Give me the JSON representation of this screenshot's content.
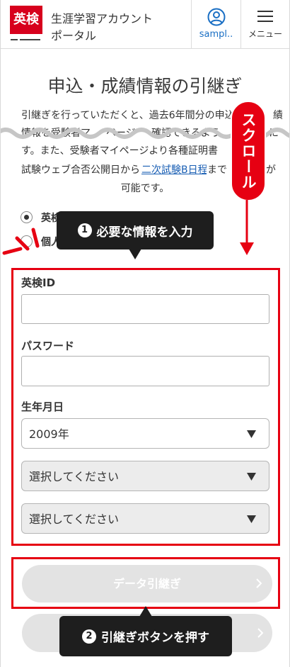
{
  "header": {
    "logo_text": "英検",
    "title_line1": "生涯学習アカウント",
    "title_line2": "ポータル",
    "user_label": "sampl..",
    "menu_label": "メニュー"
  },
  "page": {
    "heading": "申込・成績情報の引継ぎ",
    "intro": {
      "line1a": "引継ぎを行っていただくと、過去6年間分の申込",
      "line1b": "績",
      "line2a": "情報を受験者マ",
      "line2b": "ページ",
      "line2c": "確認できるよう",
      "line2d": "に",
      "line3a": "す。また、受験者マイページより各種証明書",
      "line4a": "試験ウェブ合否公開日から",
      "line4_link": "二次試験B日程",
      "line4b": "まで",
      "line4c": "が",
      "line5": "可能です。"
    }
  },
  "options": [
    {
      "label": "英検",
      "selected": true
    },
    {
      "label": "個人",
      "selected": false
    }
  ],
  "form": {
    "eiken_id_label": "英検ID",
    "eiken_id_value": "",
    "password_label": "パスワード",
    "password_value": "",
    "birth_label": "生年月日",
    "year_value": "2009年",
    "month_value": "選択してください",
    "day_value": "選択してください"
  },
  "buttons": {
    "transfer_label": "データ引継ぎ"
  },
  "annotations": {
    "scroll_label": "スクロール",
    "step1_number": "1",
    "step1_text": "必要な情報を入力",
    "step2_number": "2",
    "step2_text": "引継ぎボタンを押す"
  },
  "icons": [
    "user-icon",
    "hamburger-icon",
    "dropdown-arrow-icon",
    "chevron-right-icon",
    "scroll-arrow-icon"
  ],
  "colors": {
    "brand_red": "#d7001d",
    "annotation_red": "#e60012",
    "link_blue": "#1a5fb4",
    "callout_black": "#1e1e1e",
    "disabled_button_gray": "#e3e3e3"
  }
}
